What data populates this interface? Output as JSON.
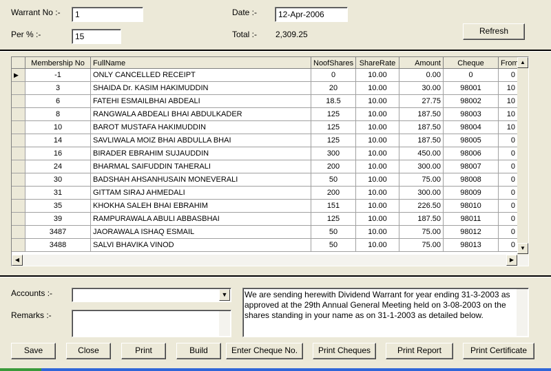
{
  "header": {
    "warrant_label": "Warrant No :-",
    "warrant_value": "1",
    "per_label": "Per % :-",
    "per_value": "15",
    "date_label": "Date :-",
    "date_value": "12-Apr-2006",
    "total_label": "Total :-",
    "total_value": "2,309.25",
    "refresh_label": "Refresh"
  },
  "grid": {
    "columns": [
      "Membership No",
      "FullName",
      "NoofShares",
      "ShareRate",
      "Amount",
      "Cheque",
      "From"
    ],
    "rows": [
      [
        "-1",
        "ONLY CANCELLED RECEIPT",
        "0",
        "10.00",
        "0.00",
        "0",
        "0"
      ],
      [
        "3",
        "SHAIDA Dr. KASIM HAKIMUDDIN",
        "20",
        "10.00",
        "30.00",
        "98001",
        "10"
      ],
      [
        "6",
        "FATEHI ESMAILBHAI ABDEALI",
        "18.5",
        "10.00",
        "27.75",
        "98002",
        "10"
      ],
      [
        "8",
        "RANGWALA ABDEALI BHAI ABDULKADER",
        "125",
        "10.00",
        "187.50",
        "98003",
        "10"
      ],
      [
        "10",
        "BAROT MUSTAFA HAKIMUDDIN",
        "125",
        "10.00",
        "187.50",
        "98004",
        "10"
      ],
      [
        "14",
        "SAVLIWALA MOIZ BHAI ABDULLA BHAI",
        "125",
        "10.00",
        "187.50",
        "98005",
        "0"
      ],
      [
        "16",
        "BIRADER EBRAHIM SUJAUDDIN",
        "300",
        "10.00",
        "450.00",
        "98006",
        "0"
      ],
      [
        "24",
        "BHARMAL SAIFUDDIN TAHERALI",
        "200",
        "10.00",
        "300.00",
        "98007",
        "0"
      ],
      [
        "30",
        "BADSHAH AHSANHUSAIN MONEVERALI",
        "50",
        "10.00",
        "75.00",
        "98008",
        "0"
      ],
      [
        "31",
        "GITTAM SIRAJ AHMEDALI",
        "200",
        "10.00",
        "300.00",
        "98009",
        "0"
      ],
      [
        "35",
        "KHOKHA SALEH BHAI EBRAHIM",
        "151",
        "10.00",
        "226.50",
        "98010",
        "0"
      ],
      [
        "39",
        "RAMPURAWALA ABULI ABBASBHAI",
        "125",
        "10.00",
        "187.50",
        "98011",
        "0"
      ],
      [
        "3487",
        "JAORAWALA ISHAQ ESMAIL",
        "50",
        "10.00",
        "75.00",
        "98012",
        "0"
      ],
      [
        "3488",
        "SALVI BHAVIKA VINOD",
        "50",
        "10.00",
        "75.00",
        "98013",
        "0"
      ]
    ]
  },
  "bottom": {
    "accounts_label": "Accounts :-",
    "accounts_value": "",
    "remarks_label": "Remarks :-",
    "remarks_value": "",
    "message": "We are sending herewith Dividend Warrant for year ending 31-3-2003 as approved at the 29th Annual General Meeting held on 3-08-2003 on the shares standing in your name as on 31-1-2003 as detailed below."
  },
  "buttons": [
    "Save",
    "Close",
    "Print",
    "Build",
    "Enter Cheque No.",
    "Print Cheques",
    "Print Report",
    "Print Certificate"
  ]
}
